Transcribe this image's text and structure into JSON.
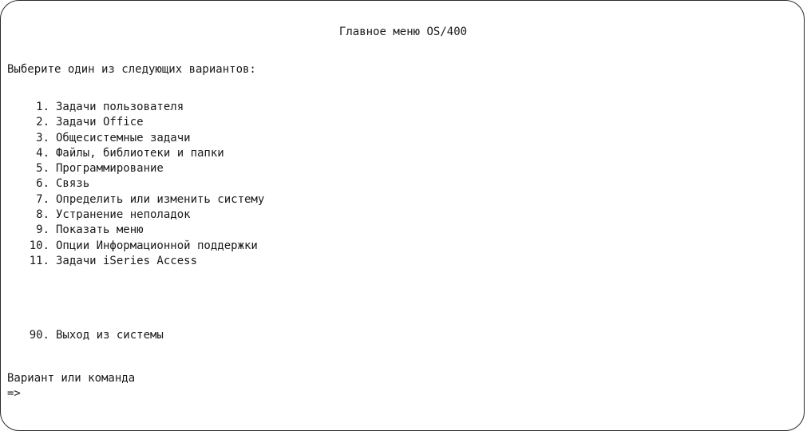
{
  "screen": {
    "title": "Главное меню OS/400",
    "instruction": "Выберите один из следующих вариантов:",
    "menu_items": [
      {
        "number": "1.",
        "label": "Задачи пользователя"
      },
      {
        "number": "2.",
        "label": "Задачи Office"
      },
      {
        "number": "3.",
        "label": "Общесистемные задачи"
      },
      {
        "number": "4.",
        "label": "Файлы, библиотеки и папки"
      },
      {
        "number": "5.",
        "label": "Программирование"
      },
      {
        "number": "6.",
        "label": "Связь"
      },
      {
        "number": "7.",
        "label": "Определить или изменить систему"
      },
      {
        "number": "8.",
        "label": "Устранение неполадок"
      },
      {
        "number": "9.",
        "label": "Показать меню"
      },
      {
        "number": "10.",
        "label": "Опции Информационной поддержки"
      },
      {
        "number": "11.",
        "label": "Задачи iSeries Access"
      }
    ],
    "exit_item": {
      "number": "90.",
      "label": "Выход из системы"
    },
    "command_label": "Вариант или команда",
    "command_prompt": "=>",
    "command_value": ""
  }
}
